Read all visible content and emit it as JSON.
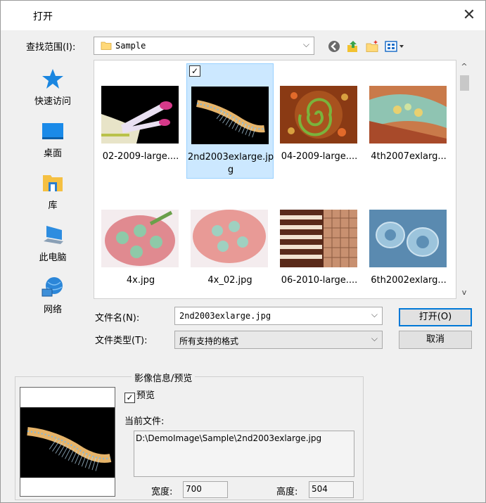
{
  "window": {
    "title": "打开",
    "close": "✕"
  },
  "lookin": {
    "label": "查找范围(I):",
    "value": "Sample"
  },
  "sidebar": {
    "items": [
      {
        "label": "快速访问"
      },
      {
        "label": "桌面"
      },
      {
        "label": "库"
      },
      {
        "label": "此电脑"
      },
      {
        "label": "网络"
      }
    ]
  },
  "files": [
    {
      "name": "02-2009-large....",
      "selected": false
    },
    {
      "name": "2nd2003exlarge.jpg",
      "selected": true
    },
    {
      "name": "04-2009-large....",
      "selected": false
    },
    {
      "name": "4th2007exlarg...",
      "selected": false
    },
    {
      "name": "4x.jpg",
      "selected": false
    },
    {
      "name": "4x_02.jpg",
      "selected": false
    },
    {
      "name": "06-2010-large....",
      "selected": false
    },
    {
      "name": "6th2002exlarg...",
      "selected": false
    }
  ],
  "filename": {
    "label": "文件名(N):",
    "value": "2nd2003exlarge.jpg"
  },
  "filetype": {
    "label": "文件类型(T):",
    "value": "所有支持的格式"
  },
  "buttons": {
    "open": "打开(O)",
    "cancel": "取消"
  },
  "info": {
    "title": "影像信息/预览",
    "preview_label": "预览",
    "preview_checked": true,
    "current_file_label": "当前文件:",
    "current_file_path": "D:\\DemoImage\\Sample\\2nd2003exlarge.jpg",
    "width_label": "宽度:",
    "width_value": "700",
    "height_label": "高度:",
    "height_value": "504"
  }
}
